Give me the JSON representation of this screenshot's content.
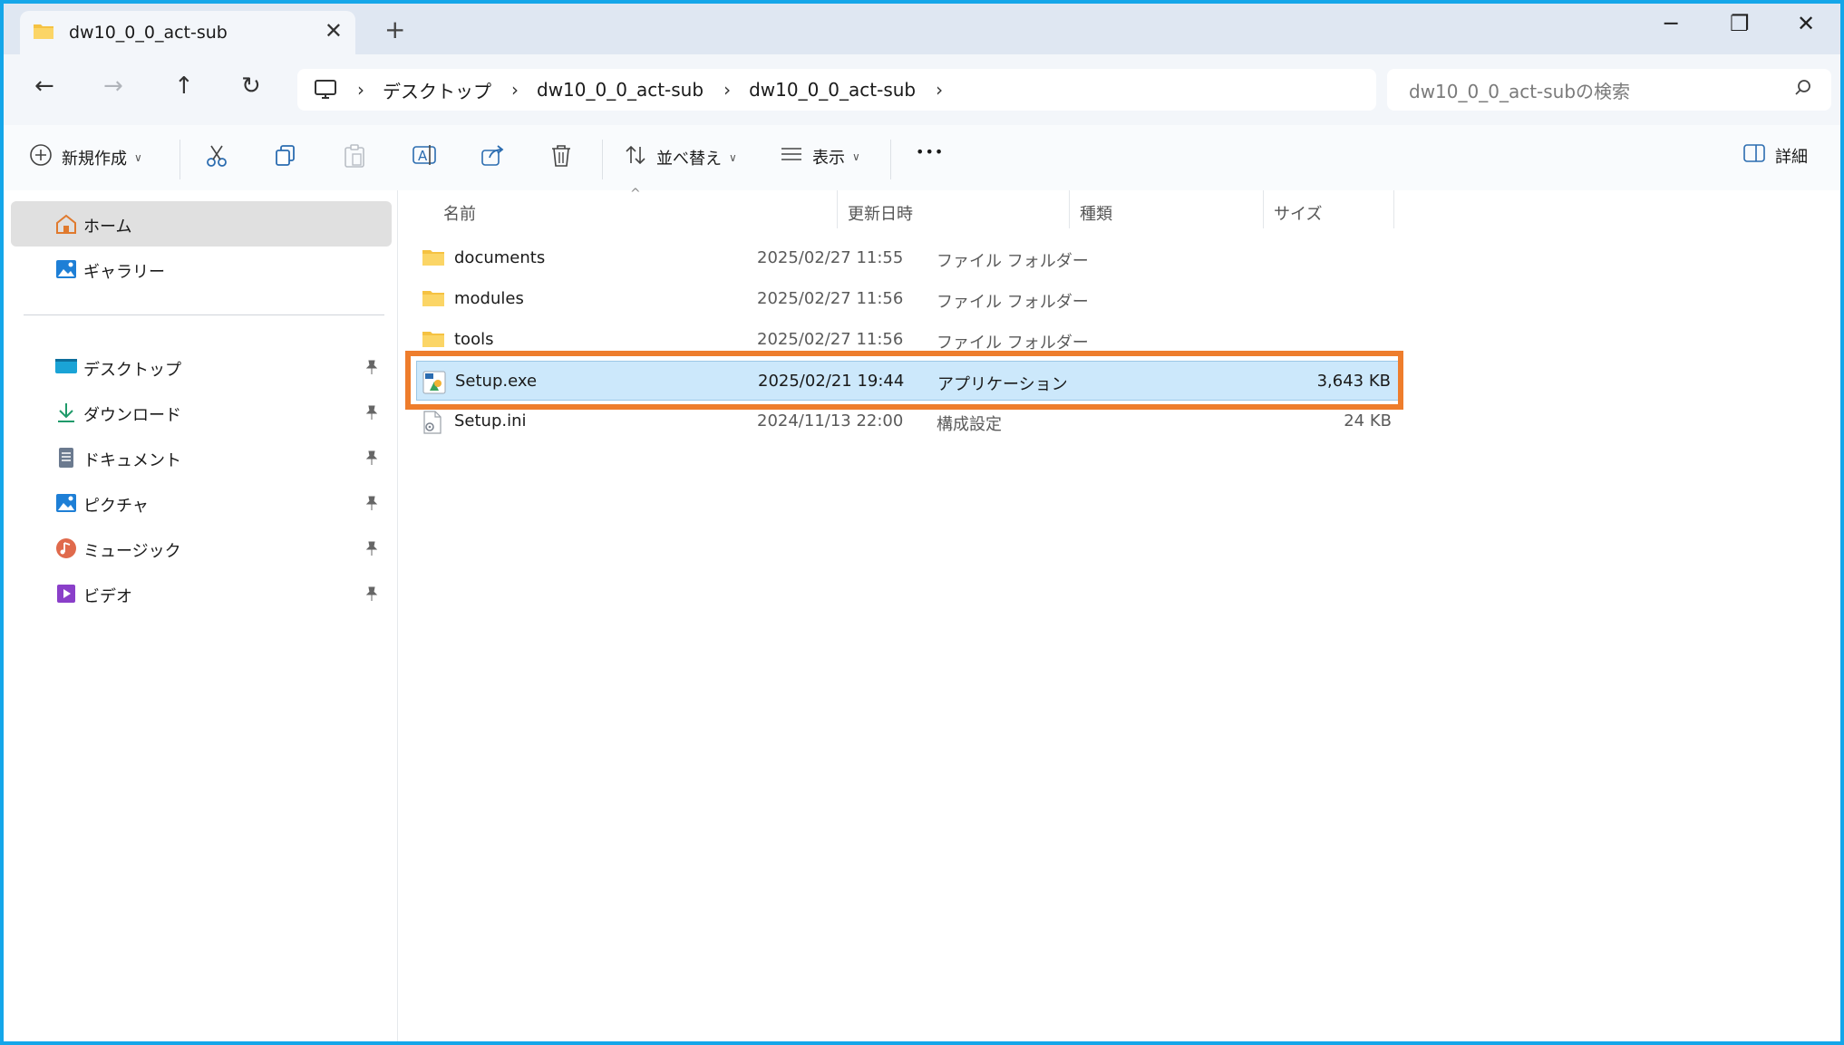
{
  "window": {
    "tab_title": "dw10_0_0_act-sub",
    "tab_close": "✕",
    "new_tab": "+",
    "minimize": "─",
    "restore": "❐",
    "close": "✕"
  },
  "nav": {
    "back": "←",
    "forward": "→",
    "up": "↑",
    "refresh": "↻"
  },
  "breadcrumb": {
    "separator": "›",
    "items": [
      "デスクトップ",
      "dw10_0_0_act-sub",
      "dw10_0_0_act-sub"
    ]
  },
  "search": {
    "placeholder": "dw10_0_0_act-subの検索"
  },
  "toolbar": {
    "new_label": "新規作成",
    "sort_label": "並べ替え",
    "view_label": "表示",
    "more_label": "•••",
    "details_label": "詳細"
  },
  "sidebar": {
    "home": "ホーム",
    "gallery": "ギャラリー",
    "items": [
      {
        "label": "デスクトップ",
        "icon": "desktop-icon"
      },
      {
        "label": "ダウンロード",
        "icon": "download-icon"
      },
      {
        "label": "ドキュメント",
        "icon": "documents-icon"
      },
      {
        "label": "ピクチャ",
        "icon": "pictures-icon"
      },
      {
        "label": "ミュージック",
        "icon": "music-icon"
      },
      {
        "label": "ビデオ",
        "icon": "video-icon"
      }
    ]
  },
  "columns": {
    "name": "名前",
    "sort_indicator": "^",
    "modified": "更新日時",
    "type": "種類",
    "size": "サイズ"
  },
  "files": [
    {
      "name": "documents",
      "modified": "2025/02/27 11:55",
      "type": "ファイル フォルダー",
      "size": "",
      "icon": "folder-icon"
    },
    {
      "name": "modules",
      "modified": "2025/02/27 11:56",
      "type": "ファイル フォルダー",
      "size": "",
      "icon": "folder-icon"
    },
    {
      "name": "tools",
      "modified": "2025/02/27 11:56",
      "type": "ファイル フォルダー",
      "size": "",
      "icon": "folder-icon"
    },
    {
      "name": "Setup.exe",
      "modified": "2025/02/21 19:44",
      "type": "アプリケーション",
      "size": "3,643 KB",
      "icon": "setup-exe-icon",
      "selected": true
    },
    {
      "name": "Setup.ini",
      "modified": "2024/11/13 22:00",
      "type": "構成設定",
      "size": "24 KB",
      "icon": "ini-file-icon"
    }
  ],
  "colors": {
    "window_border": "#14a6e9",
    "highlight_box": "#ee7d2c",
    "selection": "#cce8fb",
    "folder": "#f5c242"
  }
}
